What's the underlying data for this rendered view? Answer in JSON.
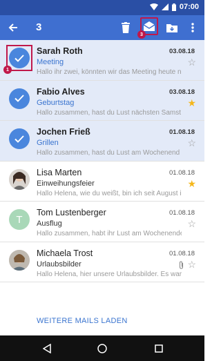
{
  "status_bar": {
    "time": "07:00",
    "icons": [
      "wifi-icon",
      "signal-icon",
      "battery-icon"
    ]
  },
  "app_bar": {
    "selected_count": "3",
    "actions": [
      "back-arrow-icon",
      "delete-icon",
      "mark-read-icon",
      "move-to-folder-icon",
      "more-vert-icon"
    ],
    "highlight_marker": "3"
  },
  "selection_marker": "1",
  "emails": [
    {
      "sender": "Sarah Roth",
      "subject": "Meeting",
      "snippet": "Hallo ihr zwei, könnten wir das Meeting heute n",
      "date": "03.08.18",
      "starred": false,
      "selected": true,
      "unread": true,
      "avatar": "check-icon"
    },
    {
      "sender": "Fabio Alves",
      "subject": "Geburtstag",
      "snippet": "Hallo zusammen, hast du Lust nächsten Samst",
      "date": "03.08.18",
      "starred": true,
      "selected": true,
      "unread": true,
      "avatar": "check-icon"
    },
    {
      "sender": "Jochen Frieß",
      "subject": "Grillen",
      "snippet": "Hallo zusammen, hast du Lust am Wochenend",
      "date": "01.08.18",
      "starred": false,
      "selected": true,
      "unread": true,
      "avatar": "check-icon"
    },
    {
      "sender": "Lisa Marten",
      "subject": "Einweihungsfeier",
      "snippet": "Hallo Helena, wie du weißt, bin ich seit August in",
      "date": "01.08.18",
      "starred": true,
      "selected": false,
      "unread": false,
      "avatar": "photo"
    },
    {
      "sender": "Tom Lustenberger",
      "subject": "Ausflug",
      "snippet": "Hallo zusammen, habt ihr Lust am Wochenende",
      "date": "01.08.18",
      "starred": false,
      "selected": false,
      "unread": false,
      "avatar": "T"
    },
    {
      "sender": "Michaela Trost",
      "subject": "Urlaubsbilder",
      "snippet": "Hallo Helena, hier unsere Urlaubsbilder. Es war",
      "date": "01.08.18",
      "starred": false,
      "selected": false,
      "unread": false,
      "avatar": "photo",
      "attachment": true
    }
  ],
  "load_more": "WEITERE MAILS LADEN",
  "nav_bar": [
    "back-triangle-icon",
    "home-circle-icon",
    "recents-square-icon"
  ],
  "colors": {
    "status_bar": "#2a4fa5",
    "app_bar": "#3f6fd0",
    "selected_row": "#e3eaf8",
    "accent": "#3a74cf",
    "star": "#f5b71b",
    "marker": "#c0184a"
  }
}
